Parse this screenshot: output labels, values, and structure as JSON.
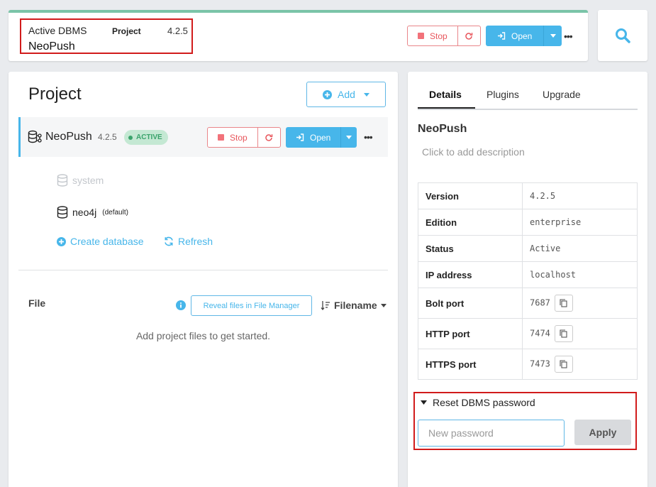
{
  "header": {
    "active_label": "Active DBMS",
    "project_label": "Project",
    "version": "4.2.5",
    "dbms_name": "NeoPush",
    "stop_label": "Stop",
    "open_label": "Open"
  },
  "project": {
    "title": "Project",
    "add_label": "Add",
    "dbms": {
      "name": "NeoPush",
      "version": "4.2.5",
      "status_badge": "ACTIVE",
      "stop_label": "Stop",
      "open_label": "Open"
    },
    "databases": [
      {
        "name": "system",
        "tag": ""
      },
      {
        "name": "neo4j",
        "tag": "(default)"
      }
    ],
    "create_db_label": "Create database",
    "refresh_label": "Refresh",
    "files": {
      "header": "File",
      "reveal_label": "Reveal files in File Manager",
      "sort_label": "Filename",
      "empty_text": "Add project files to get started."
    }
  },
  "details": {
    "tabs": [
      "Details",
      "Plugins",
      "Upgrade"
    ],
    "active_tab": "Details",
    "name": "NeoPush",
    "description_placeholder": "Click to add description",
    "rows": [
      {
        "key": "Version",
        "value": "4.2.5"
      },
      {
        "key": "Edition",
        "value": "enterprise"
      },
      {
        "key": "Status",
        "value": "Active"
      },
      {
        "key": "IP address",
        "value": "localhost"
      },
      {
        "key": "Bolt port",
        "value": "7687"
      },
      {
        "key": "HTTP port",
        "value": "7474"
      },
      {
        "key": "HTTPS port",
        "value": "7473"
      }
    ],
    "reset": {
      "title": "Reset DBMS password",
      "placeholder": "New password",
      "apply_label": "Apply"
    }
  },
  "colors": {
    "accent": "#47b6ea",
    "stop": "#e8565c",
    "active_badge": "#3aa36b",
    "highlight_box": "#d11b1b"
  }
}
